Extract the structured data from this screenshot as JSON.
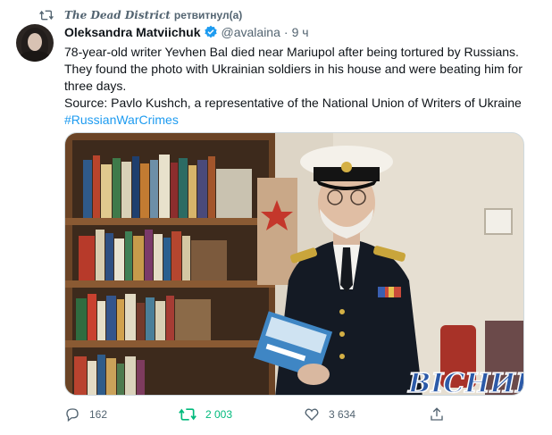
{
  "retweet_banner": {
    "account": "The Dead District",
    "suffix": "ретвитнул(а)",
    "icon": "retweet-icon"
  },
  "author": {
    "name": "Oleksandra Matviichuk",
    "handle": "@avalaina",
    "separator": "·",
    "time": "9 ч",
    "verified": true
  },
  "text": {
    "paragraph1": "78-year-old writer Yevhen Bal died near Mariupol after being tortured by Russians. They found the photo with Ukrainian soldiers in his house and were beating him for three days.",
    "paragraph2": "Source: Pavlo Kushch, a representative of the National Union of Writers of Ukraine",
    "hashtag": "#RussianWarCrimes"
  },
  "media": {
    "watermark": "ВІСНИК"
  },
  "actions": {
    "reply": {
      "icon": "reply-icon",
      "count": "162"
    },
    "retweet": {
      "icon": "retweet-icon",
      "count": "2 003"
    },
    "like": {
      "icon": "heart-icon",
      "count": "3 634"
    },
    "share": {
      "icon": "share-icon"
    }
  },
  "colors": {
    "accent": "#1d9bf0",
    "retweet_active": "#00ba7c",
    "muted": "#536471"
  }
}
